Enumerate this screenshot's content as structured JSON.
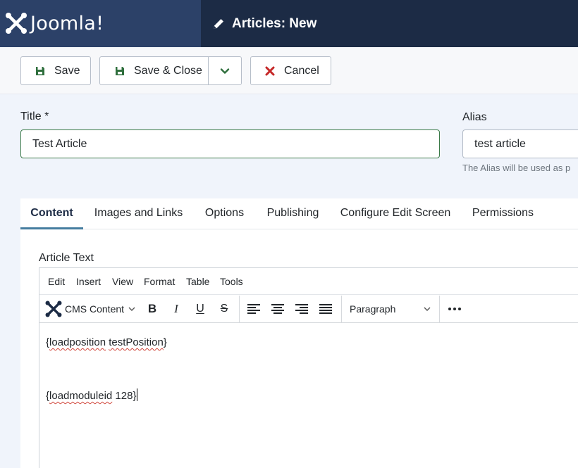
{
  "header": {
    "logo_text": "Joomla!",
    "page_title": "Articles: New"
  },
  "toolbar": {
    "save_label": "Save",
    "save_close_label": "Save & Close",
    "cancel_label": "Cancel"
  },
  "form": {
    "title_label": "Title *",
    "title_value": "Test Article",
    "alias_label": "Alias",
    "alias_value": "test article",
    "alias_hint": "The Alias will be used as p"
  },
  "tabs": [
    {
      "label": "Content"
    },
    {
      "label": "Images and Links"
    },
    {
      "label": "Options"
    },
    {
      "label": "Publishing"
    },
    {
      "label": "Configure Edit Screen"
    },
    {
      "label": "Permissions"
    }
  ],
  "editor": {
    "field_label": "Article Text",
    "menu": [
      "Edit",
      "Insert",
      "View",
      "Format",
      "Table",
      "Tools"
    ],
    "cms_content_label": "CMS Content",
    "block_format": "Paragraph",
    "content": {
      "line1_a": "{",
      "line1_b": "loadposition",
      "line1_c": " ",
      "line1_d": "testPosition",
      "line1_e": "}",
      "line2_a": "{",
      "line2_b": "loadmoduleid",
      "line2_c": " 128}"
    }
  },
  "colors": {
    "header": "#1c2b45",
    "logo_box": "#2c4168",
    "save_icon": "#2f6f3d",
    "cancel_icon": "#c52727",
    "tab_active": "#457d9f"
  },
  "icons": [
    "joomla-logo-icon",
    "pencil-icon",
    "save-icon",
    "chevron-down-icon",
    "close-icon",
    "bold-icon",
    "italic-icon",
    "underline-icon",
    "strikethrough-icon",
    "align-left-icon",
    "align-center-icon",
    "align-right-icon",
    "align-justify-icon",
    "more-icon"
  ]
}
